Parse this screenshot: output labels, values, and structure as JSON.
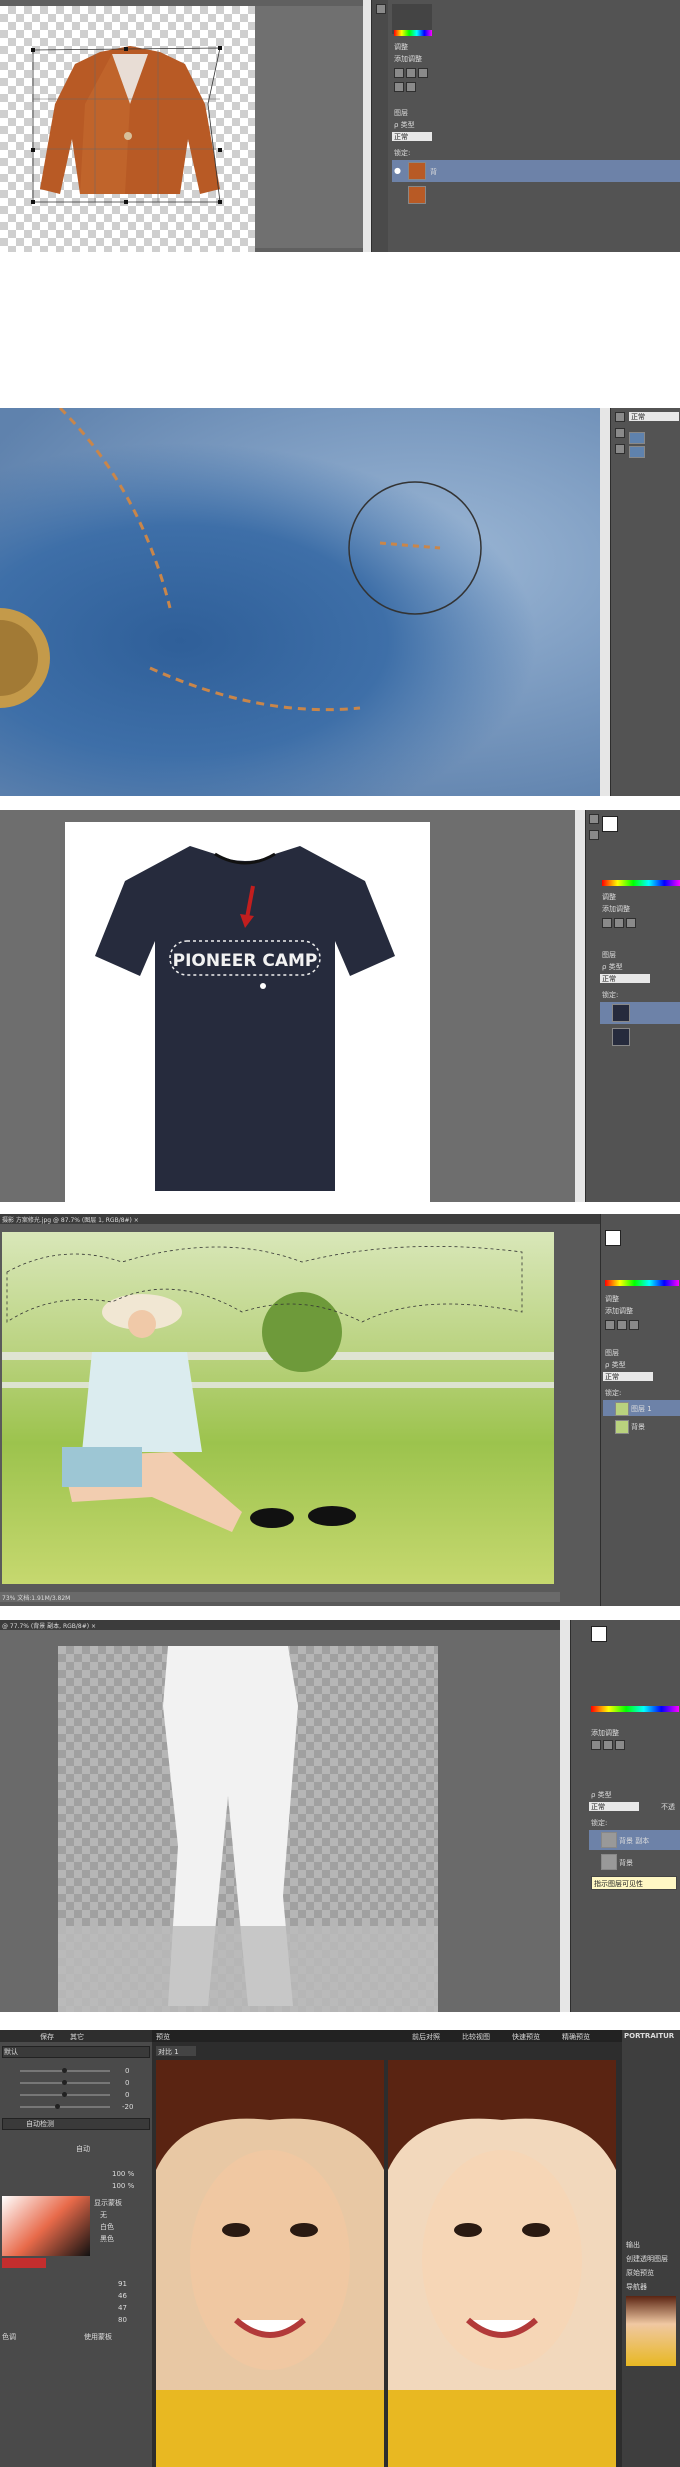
{
  "shot1": {
    "layers_tab": "图层",
    "adjust_tab": "调整",
    "add_adjust": "添加调整",
    "kind_label": "ρ 类型",
    "blend_mode": "正常",
    "lock_label": "锁定:",
    "layer_name": "背"
  },
  "shot2": {
    "mode": "正常"
  },
  "shot3": {
    "shirt_text": "PIONEER CAMP",
    "adjust_tab": "调整",
    "add_adjust": "添加调整",
    "layers_tab": "图层",
    "kind_label": "ρ 类型",
    "blend_mode": "正常",
    "lock_label": "锁定:"
  },
  "shot4": {
    "doc_tab": "摄影 方案修光.jpg @ 87.7% (图层 1, RGB/8#) ×",
    "status": "73%    文档:1.91M/3.82M",
    "adjust_tab": "调整",
    "add_adjust": "添加调整",
    "layers_tab": "图层",
    "kind_label": "ρ 类型",
    "blend_mode": "正常",
    "lock_label": "锁定:",
    "layer1": "图层 1",
    "layer2": "背景"
  },
  "shot5": {
    "doc_tab": "@ 77.7% (背景 副本, RGB/8#) ×",
    "add_adjust": "添加调整",
    "kind_label": "ρ 类型",
    "blend_mode": "正常",
    "opacity_label": "不透",
    "lock_label": "锁定:",
    "layer1": "背景 副本",
    "layer2": "背景",
    "tooltip": "指示图层可见性"
  },
  "shot6": {
    "top_btn_save": "保存",
    "top_btn_other": "其它",
    "preset_label": "默认",
    "auto_label": "自动",
    "auto_detect": "自动检测",
    "slider_values": [
      "0",
      "0",
      "0",
      "-20"
    ],
    "pct1": "100 %",
    "pct2": "100 %",
    "display_mask": "显示蒙板",
    "radio1": "无",
    "radio2": "白色",
    "radio3": "黑色",
    "color_values": [
      "91",
      "46",
      "47",
      "80"
    ],
    "bottom_label": "色调",
    "use_mask": "使用蒙板",
    "preview_tab": "预览",
    "view_before": "前后对照",
    "view_compare": "比较视图",
    "view_fast": "快速预览",
    "view_accurate": "精确预览",
    "image_tab": "对比 1",
    "right_title": "PORTRAITUR",
    "right_item1": "输出",
    "right_item2": "创建透明图层",
    "right_item3": "原始预览",
    "right_item4": "导航器"
  }
}
